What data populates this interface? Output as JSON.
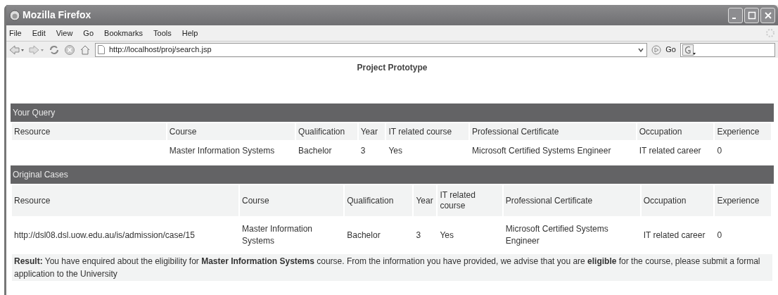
{
  "window": {
    "title": "Mozilla Firefox"
  },
  "menu": [
    "File",
    "Edit",
    "View",
    "Go",
    "Bookmarks",
    "Tools",
    "Help"
  ],
  "address_bar": {
    "url": "http://localhost/proj/search.jsp",
    "go_label": "Go"
  },
  "page": {
    "heading": "Project Prototype",
    "query": {
      "title": "Your Query",
      "columns": [
        "Resource",
        "Course",
        "Qualification",
        "Year",
        "IT related course",
        "Professional Certificate",
        "Occupation",
        "Experience"
      ],
      "row": {
        "course": "Master Information Systems",
        "qualification": "Bachelor",
        "year": "3",
        "it_related_course": "Yes",
        "professional_certificate": "Microsoft Certified Systems Engineer",
        "occupation": "IT related career",
        "experience": "0"
      }
    },
    "cases": {
      "title": "Original Cases",
      "columns": [
        "Resource",
        "Course",
        "Qualification",
        "Year",
        "IT related course",
        "Professional Certificate",
        "Occupation",
        "Experience"
      ],
      "row": {
        "resource": "http://dsl08.dsl.uow.edu.au/is/admission/case/15",
        "course": "Master Information Systems",
        "qualification": "Bachelor",
        "year": "3",
        "it_related_course": "Yes",
        "professional_certificate": "Microsoft Certified Systems Engineer",
        "occupation": "IT related career",
        "experience": "0"
      }
    },
    "result": "**Result:** You have enquired about the eligibility for **Master Information Systems** course. From the information you have provided, we advise that you are **eligible** for the course, please submit a formal application to the University"
  }
}
